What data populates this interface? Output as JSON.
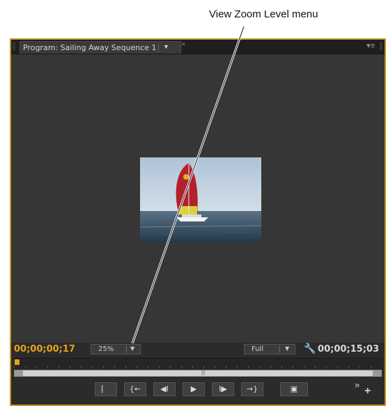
{
  "callout": {
    "label": "View Zoom Level menu"
  },
  "panel": {
    "tab_title": "Program: Sailing Away Sequence 1",
    "tab_dropdown_icon": "triangle-down-icon",
    "tab_close_icon": "close-icon",
    "panel_menu_icon": "panel-menu-icon"
  },
  "monitor": {
    "current_timecode": "00;00;00;17",
    "zoom_level": "25%",
    "resolution": "Full",
    "duration_timecode": "00;00;15;03"
  },
  "transport": {
    "buttons": [
      {
        "name": "mark-in-button",
        "glyph": "⎸"
      },
      {
        "name": "go-to-in-button",
        "glyph": "{←"
      },
      {
        "name": "step-back-button",
        "glyph": "◀I"
      },
      {
        "name": "play-button",
        "glyph": "▶"
      },
      {
        "name": "step-forward-button",
        "glyph": "I▶"
      },
      {
        "name": "go-to-out-button",
        "glyph": "→}"
      },
      {
        "name": "export-frame-button",
        "glyph": "▣"
      }
    ],
    "more_glyph": "»",
    "add_glyph": "+"
  },
  "colors": {
    "accent": "#e6a21a",
    "panel_bg": "#2b2b2b",
    "border": "#c89a2a"
  }
}
